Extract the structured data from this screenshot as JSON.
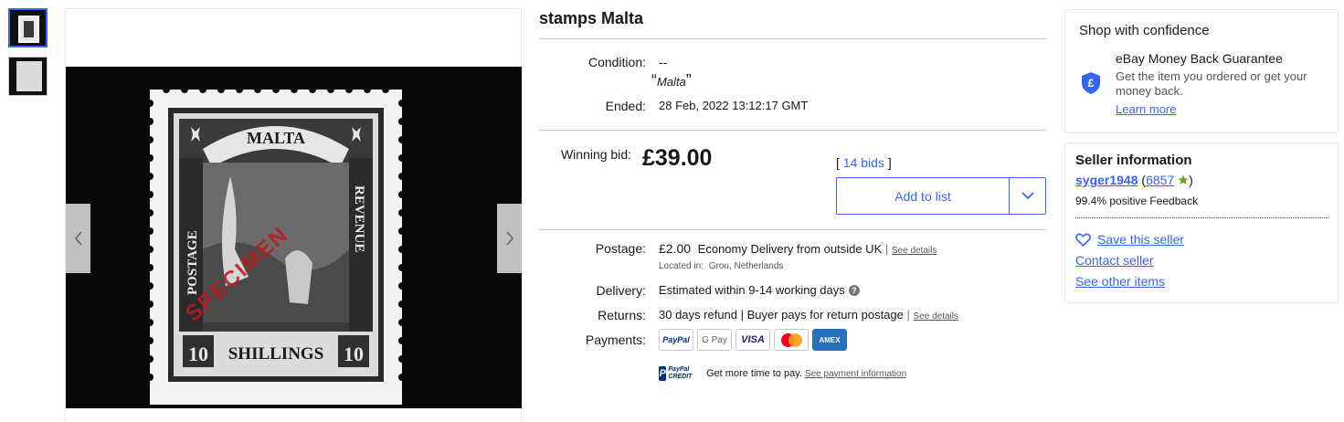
{
  "listing": {
    "title": "stamps Malta",
    "condition_label": "Condition:",
    "condition_value": "--",
    "quote_text": "Malta",
    "ended_label": "Ended:",
    "ended_value": "28 Feb, 2022  13:12:17 GMT",
    "winning_bid_label": "Winning bid:",
    "price": "£39.00",
    "bids_link": "14 bids",
    "add_to_list": "Add to list"
  },
  "shipping": {
    "postage_label": "Postage:",
    "postage_price": "£2.00",
    "postage_method": "Economy Delivery from outside UK",
    "see_details": "See details",
    "located_label": "Located in:",
    "located_value": "Grou, Netherlands",
    "delivery_label": "Delivery:",
    "delivery_value": "Estimated within 9-14 working days",
    "returns_label": "Returns:",
    "returns_value": "30 days refund | Buyer pays for return postage",
    "returns_see_details": "See details",
    "payments_label": "Payments:",
    "payment_methods": [
      "PayPal",
      "G Pay",
      "VISA",
      "Mastercard",
      "AMEX"
    ],
    "paypal_credit_text": "Get more time to pay.",
    "paypal_credit_link": "See payment information",
    "paypal_credit_logo": "PayPal CREDIT"
  },
  "confidence": {
    "heading": "Shop with confidence",
    "guarantee_title": "eBay Money Back Guarantee",
    "guarantee_text": "Get the item you ordered or get your money back.",
    "learn_more": "Learn more"
  },
  "seller": {
    "heading": "Seller information",
    "name": "syger1948",
    "score": "6857",
    "feedback": "99.4% positive Feedback",
    "save_seller": "Save this seller",
    "contact_seller": "Contact seller",
    "see_other_items": "See other items"
  },
  "stamp_image": {
    "top_text": "MALTA",
    "left_text": "POSTAGE",
    "right_text": "REVENUE",
    "bottom_text": "SHILLINGS",
    "value_left": "10",
    "value_right": "10",
    "overprint": "SPECIMEN"
  },
  "colors": {
    "accent": "#3665f3",
    "star": "#5ba71b"
  },
  "icons": {
    "prev": "chevron-left-icon",
    "next": "chevron-right-icon",
    "dropdown": "chevron-down-icon",
    "info": "info-icon",
    "shield": "shield-pound-icon",
    "heart": "heart-icon",
    "star": "star-icon"
  }
}
